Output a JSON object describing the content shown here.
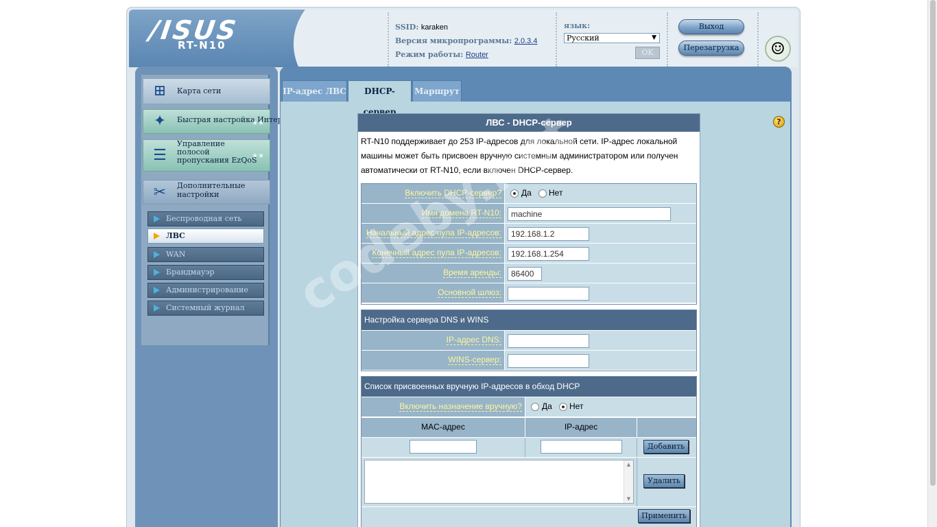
{
  "header": {
    "brand": "/ISUS",
    "model": "RT-N10",
    "ssid_label": "SSID:",
    "ssid_value": "karaken",
    "firmware_label": "Версия микропрограммы:",
    "firmware_value": "2.0.3.4",
    "mode_label": "Режим работы:",
    "mode_value": "Router",
    "language_label": "язык:",
    "language_value": "Русский",
    "ok_label": "OK",
    "logout_label": "Выход",
    "reboot_label": "Перезагрузка"
  },
  "sidebar": {
    "main_items": [
      {
        "label": "Карта сети"
      },
      {
        "label": "Быстрая настройка Интернет"
      },
      {
        "label": "Управление\nполосой\nпропускания EzQoS"
      },
      {
        "label": "Дополнительные настройки"
      }
    ],
    "sub_items": [
      {
        "label": "Беспроводная сеть"
      },
      {
        "label": "ЛВС"
      },
      {
        "label": "WAN"
      },
      {
        "label": "Брандмауэр"
      },
      {
        "label": "Администрирование"
      },
      {
        "label": "Системный журнал"
      }
    ]
  },
  "tabs": [
    {
      "label": "IP-адрес ЛВС"
    },
    {
      "label": "DHCP-сервер"
    },
    {
      "label": "Маршрут"
    }
  ],
  "form": {
    "title": "ЛВС - DHCP-сервер",
    "description": "RT-N10 поддерживает до 253 IP-адресов для локальной сети. IP-адрес локальной машины может быть присвоен вручную системным администратором или получен автоматически от RT-N10, если включен DHCP-сервер.",
    "enable_dhcp_label": "Включить DHCP-сервер?",
    "yes_label": "Да",
    "no_label": "Нет",
    "domain_label": "Имя домена RT-N10:",
    "domain_value": "machine",
    "start_label": "Начальный адрес пула IP-адресов:",
    "start_value": "192.168.1.2",
    "end_label": "Конечный адрес пула IP-адресов:",
    "end_value": "192.168.1.254",
    "lease_label": "Время аренды:",
    "lease_value": "86400",
    "gateway_label": "Основной шлюз:",
    "gateway_value": "",
    "dns_section": "Настройка сервера DNS и WINS",
    "dns_label": "IP-адрес DNS:",
    "dns_value": "",
    "wins_label": "WINS-сервер:",
    "wins_value": "",
    "manual_section": "Список присвоенных вручную IP-адресов в обход DHCP",
    "manual_enable_label": "Включить назначение вручную?",
    "mac_header": "MAC-адрес",
    "ip_header": "IP-адрес",
    "add_label": "Добавить",
    "delete_label": "Удалить",
    "apply_label": "Применить"
  },
  "watermark": "codeby.net"
}
